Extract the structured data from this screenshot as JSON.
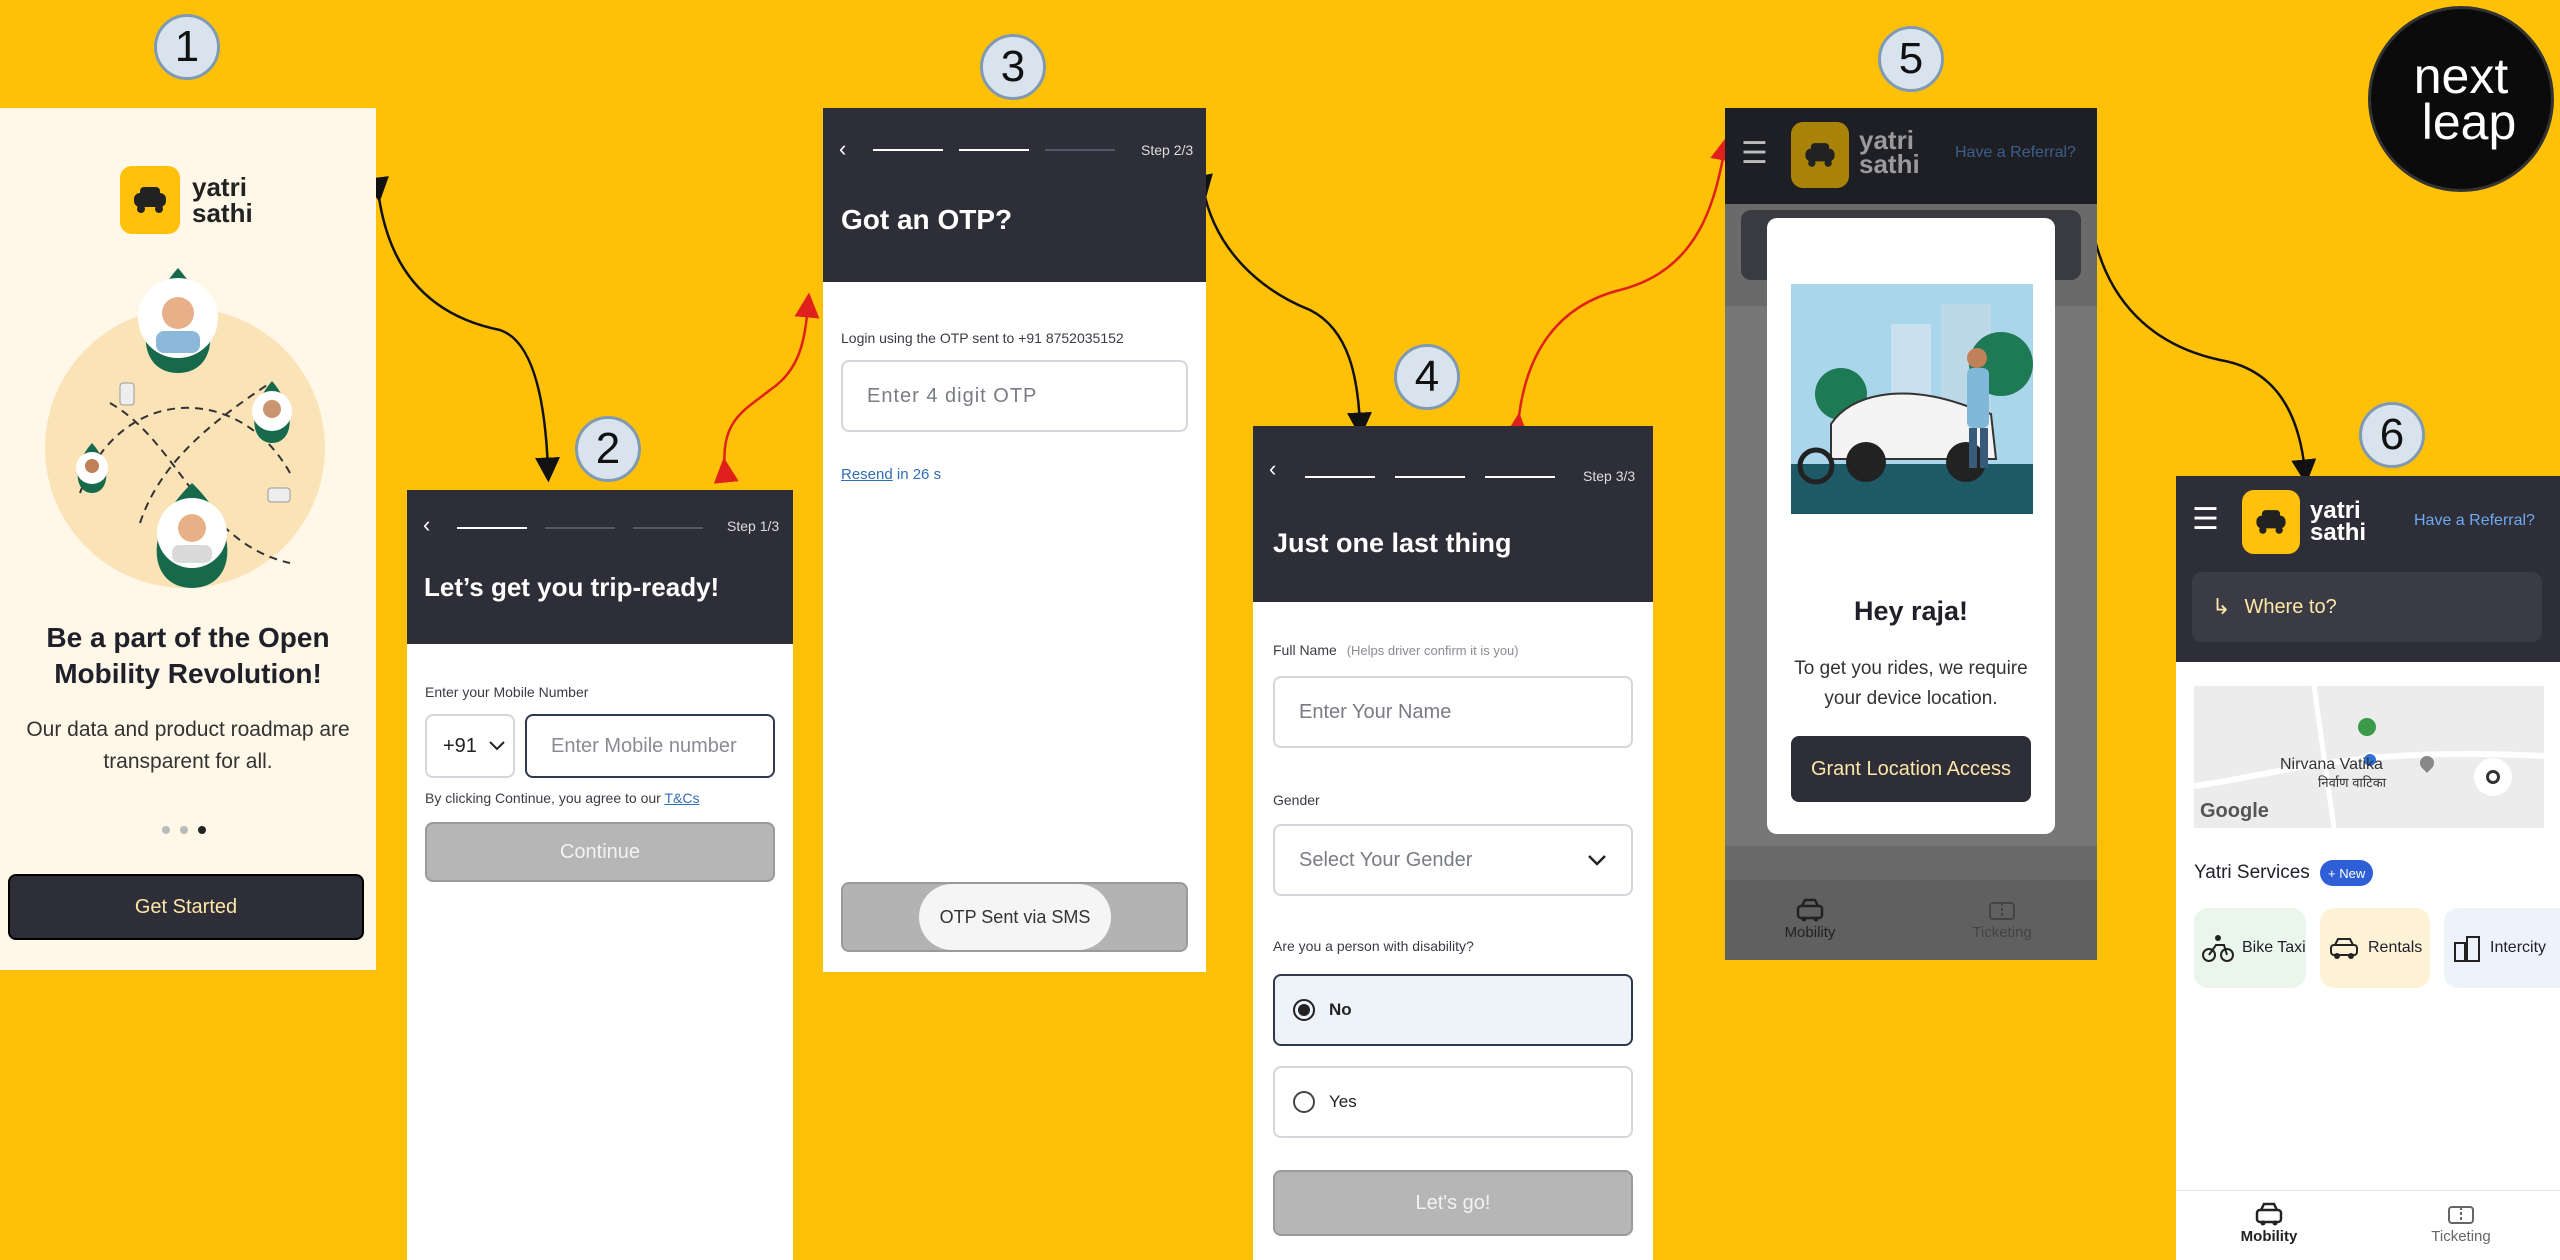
{
  "steps": [
    "1",
    "2",
    "3",
    "4",
    "5",
    "6"
  ],
  "brand": {
    "line1": "yatri",
    "line2": "sathi",
    "corner_logo_line1": "next",
    "corner_logo_line2": "leap"
  },
  "s1": {
    "headline": "Be a part of the Open Mobility Revolution!",
    "body": "Our data and product roadmap are transparent for all.",
    "cta": "Get Started"
  },
  "s2": {
    "step": "Step 1/3",
    "title": "Let’s get you trip-ready!",
    "label": "Enter your Mobile Number",
    "country_code": "+91",
    "mobile_placeholder": "Enter Mobile number",
    "terms_prefix": "By clicking Continue, you agree to our",
    "terms_link": "T&Cs",
    "cta": "Continue"
  },
  "s3": {
    "step": "Step 2/3",
    "title": "Got an OTP?",
    "info": "Login using the OTP sent to +91 8752035152",
    "otp_placeholder": "Enter 4 digit OTP",
    "resend": "Resend",
    "timer": "in 26 s",
    "toast": "OTP Sent via SMS"
  },
  "s4": {
    "step": "Step 3/3",
    "title": "Just one last thing",
    "name_label": "Full Name",
    "name_hint": "(Helps driver confirm it is you)",
    "name_placeholder": "Enter Your Name",
    "gender_label": "Gender",
    "gender_placeholder": "Select Your Gender",
    "disability_label": "Are you a person with disability?",
    "opt_no": "No",
    "opt_yes": "Yes",
    "cta": "Let's go!"
  },
  "s5": {
    "referral": "Have a Referral?",
    "greeting": "Hey raja!",
    "message": "To get you rides, we require your device location.",
    "cta": "Grant Location Access",
    "tab_mobility": "Mobility",
    "tab_ticketing": "Ticketing"
  },
  "s6": {
    "referral": "Have a Referral?",
    "search": "Where to?",
    "map_place": "Nirvana Vatika",
    "map_place_local": "निर्वाण वाटिका",
    "map_brand": "Google",
    "services_title": "Yatri Services",
    "new_badge": "+ New",
    "services": [
      "Bike Taxi",
      "Rentals",
      "Intercity"
    ],
    "tab_mobility": "Mobility",
    "tab_ticketing": "Ticketing"
  },
  "colors": {
    "background": "#FFC107",
    "dark": "#2D2E38",
    "accent": "#FDE6A7",
    "link": "#2F6FB5",
    "arrow_black": "#111111",
    "arrow_red": "#E0201C"
  }
}
